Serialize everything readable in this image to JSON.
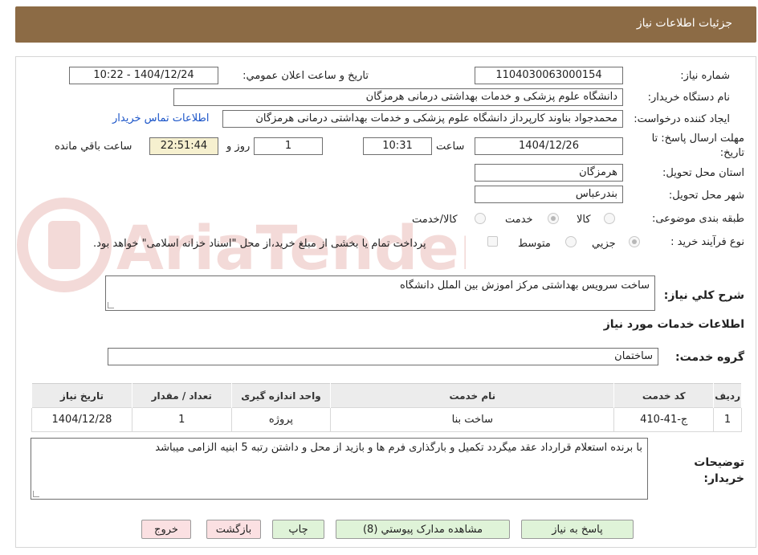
{
  "header": {
    "title": "جزئیات اطلاعات نیاز"
  },
  "fields": {
    "need_number_label": "شماره نیاز:",
    "need_number": "1104030063000154",
    "announce_label": "تاریخ و ساعت اعلان عمومي:",
    "announce_value": "1404/12/24 - 10:22",
    "buyer_org_label": "نام دستگاه خریدار:",
    "buyer_org": "دانشگاه علوم پزشکی و خدمات بهداشتی درمانی هرمزگان",
    "requester_label": "ایجاد کننده درخواست:",
    "requester": "محمدجواد بناوند کارپرداز دانشگاه علوم پزشکی و خدمات بهداشتی درمانی هرمزگان",
    "buyer_contact_link": "اطلاعات تماس خریدار",
    "deadline_label": "مهلت ارسال پاسخ: تا تاریخ:",
    "deadline_date": "1404/12/26",
    "deadline_time_label": "ساعت",
    "deadline_time": "10:31",
    "days_value": "1",
    "days_label": "روز و",
    "remaining_time": "22:51:44",
    "remaining_label": "ساعت باقي مانده",
    "province_label": "استان محل تحویل:",
    "province": "هرمزگان",
    "city_label": "شهر محل تحویل:",
    "city": "بندرعباس",
    "category_label": "طبقه بندی موضوعی:",
    "category_options": [
      "کالا",
      "خدمت",
      "کالا/خدمت"
    ],
    "process_label": "نوع فرآیند خرید :",
    "process_options": [
      "جزيي",
      "متوسط"
    ],
    "payment_note": "پرداخت تمام یا بخشی از مبلغ خرید،از محل \"اسناد خزانه اسلامی\" خواهد بود.",
    "description_label": "شرح کلي نياز:",
    "description": "ساخت سرویس بهداشتی مرکز اموزش بین الملل  دانشگاه",
    "services_heading": "اطلاعات خدمات مورد نياز",
    "service_group_label": "گروه خدمت:",
    "service_group": "ساختمان",
    "buyer_notes_label": "توضیحات خریدار:",
    "buyer_notes": "با برنده  استعلام قرارداد عقد میگردد  تکمیل و بارگذاری  فرم ها  و بازید از محل  و   داشتن رتبه 5 ابنیه  الزامی میباشد"
  },
  "table": {
    "headers": [
      "ردیف",
      "کد خدمت",
      "نام خدمت",
      "واحد اندازه گیری",
      "تعداد / مقدار",
      "تاریخ نیاز"
    ],
    "rows": [
      [
        "1",
        "ج-41-410",
        "ساخت بنا",
        "پروژه",
        "1",
        "1404/12/28"
      ]
    ]
  },
  "buttons": {
    "reply": "پاسخ به نیاز",
    "attachments": "مشاهده مدارک پیوستي (8)",
    "print": "چاپ",
    "back": "بازگشت",
    "exit": "خروج"
  },
  "watermark_text": "AriaTender.neT",
  "colors": {
    "header_bg": "#8c6b45",
    "link": "#1a54c8",
    "time_bg": "#f6f0cf",
    "button_green": "#dff3d8",
    "button_pink": "#fbe0e2"
  }
}
